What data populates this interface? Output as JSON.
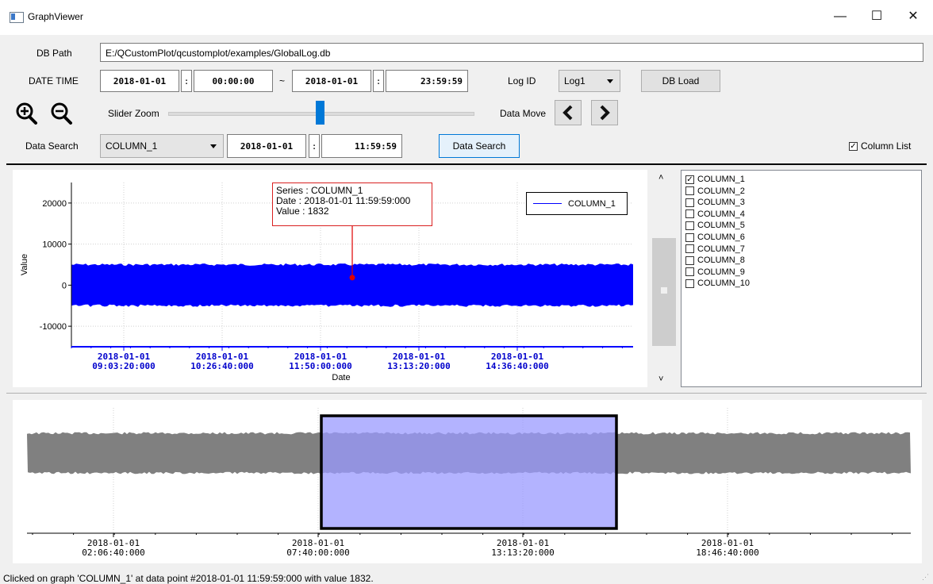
{
  "window": {
    "title": "GraphViewer",
    "min_glyph": "—",
    "max_glyph": "☐",
    "close_glyph": "✕"
  },
  "form": {
    "db_path_label": "DB Path",
    "db_path_value": "E:/QCustomPlot/qcustomplot/examples/GlobalLog.db",
    "datetime_label": "DATE TIME",
    "start_date": "2018-01-01",
    "colon": ":",
    "start_time": "00:00:00",
    "tilde": "~",
    "end_date": "2018-01-01",
    "end_time": "23:59:59",
    "logid_label": "Log ID",
    "logid_value": "Log1",
    "db_load_label": "DB Load",
    "slider_zoom_label": "Slider Zoom",
    "slider_value": 0.5,
    "data_move_label": "Data Move",
    "data_search_label": "Data Search",
    "search_column": "COLUMN_1",
    "search_date": "2018-01-01",
    "search_time": "11:59:59",
    "search_button_label": "Data Search",
    "column_list_label": "Column List"
  },
  "columns": [
    {
      "name": "COLUMN_1",
      "checked": true
    },
    {
      "name": "COLUMN_2",
      "checked": false
    },
    {
      "name": "COLUMN_3",
      "checked": false
    },
    {
      "name": "COLUMN_4",
      "checked": false
    },
    {
      "name": "COLUMN_5",
      "checked": false
    },
    {
      "name": "COLUMN_6",
      "checked": false
    },
    {
      "name": "COLUMN_7",
      "checked": false
    },
    {
      "name": "COLUMN_8",
      "checked": false
    },
    {
      "name": "COLUMN_9",
      "checked": false
    },
    {
      "name": "COLUMN_10",
      "checked": false
    }
  ],
  "tooltip": {
    "line1": "Series : COLUMN_1",
    "line2": "Date : 2018-01-01 11:59:59:000",
    "line3": "Value : 1832"
  },
  "status_text": "Clicked on graph 'COLUMN_1' at data point #2018-01-01 11:59:59:000 with value 1832.",
  "chart_data": [
    {
      "type": "line",
      "xlabel": "Date",
      "ylabel": "Value",
      "ylim": [
        -15000,
        25000
      ],
      "yticks": [
        20000,
        10000,
        0,
        -10000
      ],
      "ytick_labels": [
        "20000",
        "10000",
        "0",
        "-10000"
      ],
      "xticks": [
        {
          "date": "2018-01-01",
          "time": "09:03:20:000"
        },
        {
          "date": "2018-01-01",
          "time": "10:26:40:000"
        },
        {
          "date": "2018-01-01",
          "time": "11:50:00:000"
        },
        {
          "date": "2018-01-01",
          "time": "13:13:20:000"
        },
        {
          "date": "2018-01-01",
          "time": "14:36:40:000"
        }
      ],
      "series": [
        {
          "name": "COLUMN_1",
          "band_min": -5000,
          "band_max": 5000,
          "color": "#0000ff"
        }
      ],
      "highlight": {
        "date": "2018-01-01 11:59:59:000",
        "value": 1832,
        "color": "#e00000"
      },
      "legend": "top-right",
      "grid": true
    },
    {
      "type": "area",
      "series": [
        {
          "band_min": -5000,
          "band_max": 5000,
          "color": "#808080"
        }
      ],
      "xticks": [
        {
          "date": "2018-01-01",
          "time": "02:06:40:000"
        },
        {
          "date": "2018-01-01",
          "time": "07:40:00:000"
        },
        {
          "date": "2018-01-01",
          "time": "13:13:20:000"
        },
        {
          "date": "2018-01-01",
          "time": "18:46:40:000"
        }
      ],
      "selection_color": "#9a9aff",
      "grid": true
    }
  ]
}
